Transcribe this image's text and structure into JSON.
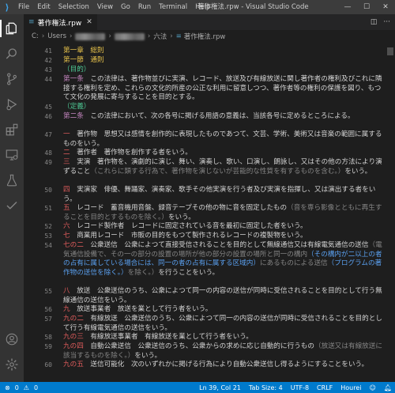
{
  "window": {
    "title": "著作権法.rpw - Visual Studio Code",
    "menu": [
      "File",
      "Edit",
      "Selection",
      "View",
      "Go",
      "Run",
      "Terminal",
      "Help"
    ],
    "controls": [
      "minimize",
      "maximize",
      "close"
    ]
  },
  "activity_bar": {
    "items": [
      "explorer-icon",
      "search-icon",
      "source-control-icon",
      "run-debug-icon",
      "extensions-icon",
      "remote-explorer-icon",
      "testing-icon",
      "check-icon"
    ],
    "bottom": [
      "account-icon",
      "settings-gear-icon"
    ]
  },
  "tabs": [
    {
      "label": "著作権法.rpw",
      "active": true
    }
  ],
  "breadcrumb": {
    "items": [
      "C:",
      "Users",
      "六法",
      "著作権法.rpw"
    ]
  },
  "editor": {
    "lines": [
      {
        "num": "41",
        "segments": [
          {
            "t": "第一章　総則",
            "c": "head"
          }
        ]
      },
      {
        "num": "42",
        "segments": [
          {
            "t": "第一節　通則",
            "c": "head"
          }
        ]
      },
      {
        "num": "43",
        "segments": [
          {
            "t": "（目的）",
            "c": "label"
          }
        ]
      },
      {
        "num": "44",
        "segments": [
          {
            "t": "第一条",
            "c": "art"
          },
          {
            "t": "　この法律は、著作物並びに実演、レコード、放送及び有線放送に関し著作者の権利及びこれに隣接する権利を定め、これらの文化的所産の公正な利用に留意しつつ、著作者等の権利の保護を図り、もつて文化の発展に寄与することを目的とする。",
            "c": ""
          }
        ]
      },
      {
        "num": "45",
        "segments": [
          {
            "t": "（定義）",
            "c": "label"
          }
        ]
      },
      {
        "num": "46",
        "segments": [
          {
            "t": "第二条",
            "c": "art"
          },
          {
            "t": "　この法律において、次の各号に掲げる用語の意義は、当該各号に定めるところによる。",
            "c": ""
          }
        ]
      },
      {
        "num": "47",
        "segments": [
          {
            "t": "一",
            "c": "num"
          },
          {
            "t": "　著作物　思想又は感情を創作的に表現したものであつて、文芸、学術、美術又は音楽の範囲に属するものをいう。",
            "c": ""
          }
        ]
      },
      {
        "num": "48",
        "segments": [
          {
            "t": "二",
            "c": "num"
          },
          {
            "t": "　著作者　著作物を創作する者をいう。",
            "c": ""
          }
        ]
      },
      {
        "num": "49",
        "segments": [
          {
            "t": "三",
            "c": "num"
          },
          {
            "t": "　実演　著作物を、演劇的に演じ、舞い、演奏し、歌い、口演し、朗詠し、又はその他の方法により演ずること",
            "c": ""
          },
          {
            "t": "（これらに類する行為で、著作物を演じないが芸能的な性質を有するものを含む。）",
            "c": "paren"
          },
          {
            "t": "をいう。",
            "c": ""
          }
        ]
      },
      {
        "num": "50",
        "segments": [
          {
            "t": "四",
            "c": "num"
          },
          {
            "t": "　実演家　俳優、舞踊家、演奏家、歌手その他実演を行う者及び実演を指揮し、又は演出する者をいう。",
            "c": ""
          }
        ]
      },
      {
        "num": "51",
        "segments": [
          {
            "t": "五",
            "c": "num"
          },
          {
            "t": "　レコード　蓄音機用音盤、録音テープその他の物に音を固定したもの",
            "c": ""
          },
          {
            "t": "（音を専ら影像とともに再生することを目的とするものを除く。）",
            "c": "paren"
          },
          {
            "t": "をいう。",
            "c": ""
          }
        ]
      },
      {
        "num": "52",
        "segments": [
          {
            "t": "六",
            "c": "num"
          },
          {
            "t": "　レコード製作者　レコードに固定されている音を最初に固定した者をいう。",
            "c": ""
          }
        ]
      },
      {
        "num": "53",
        "segments": [
          {
            "t": "七",
            "c": "num"
          },
          {
            "t": "　商業用レコード　市販の目的をもつて製作されるレコードの複製物をいう。",
            "c": ""
          }
        ]
      },
      {
        "num": "54",
        "segments": [
          {
            "t": "七の二",
            "c": "num"
          },
          {
            "t": "　公衆送信　公衆によつて直接受信されることを目的として無線通信又は有線電気通信の送信",
            "c": ""
          },
          {
            "t": "（電気通信設備で、その一の部分の設置の場所が他の部分の設置の場所と同一の構内",
            "c": "paren"
          },
          {
            "t": "（その構内が二以上の者の占有に属している場合には、同一の者の占有に属する区域内）",
            "c": "blue"
          },
          {
            "t": "にあるものによる送信",
            "c": "paren"
          },
          {
            "t": "（プログラムの著作物の送信を除く。）",
            "c": "blue"
          },
          {
            "t": "を除く。）",
            "c": "paren"
          },
          {
            "t": "を行うことをいう。",
            "c": ""
          }
        ]
      },
      {
        "num": "55",
        "segments": [
          {
            "t": "八",
            "c": "num"
          },
          {
            "t": "　放送　公衆送信のうち、公衆によつて同一の内容の送信が同時に受信されることを目的として行う無線通信の送信をいう。",
            "c": ""
          }
        ]
      },
      {
        "num": "56",
        "segments": [
          {
            "t": "九",
            "c": "num"
          },
          {
            "t": "　放送事業者　放送を業として行う者をいう。",
            "c": ""
          }
        ]
      },
      {
        "num": "57",
        "segments": [
          {
            "t": "九の二",
            "c": "num"
          },
          {
            "t": "　有線放送　公衆送信のうち、公衆によつて同一の内容の送信が同時に受信されることを目的として行う有線電気通信の送信をいう。",
            "c": ""
          }
        ]
      },
      {
        "num": "58",
        "segments": [
          {
            "t": "九の三",
            "c": "num"
          },
          {
            "t": "　有線放送事業者　有線放送を業として行う者をいう。",
            "c": ""
          }
        ]
      },
      {
        "num": "59",
        "segments": [
          {
            "t": "九の四",
            "c": "num"
          },
          {
            "t": "　自動公衆送信　公衆送信のうち、公衆からの求めに応じ自動的に行うもの",
            "c": ""
          },
          {
            "t": "（放送又は有線放送に該当するものを除く。）",
            "c": "paren"
          },
          {
            "t": "をいう。",
            "c": ""
          }
        ]
      },
      {
        "num": "60",
        "segments": [
          {
            "t": "九の五",
            "c": "num"
          },
          {
            "t": "　送信可能化　次のいずれかに掲げる行為により自動公衆送信し得るようにすることをいう。",
            "c": ""
          }
        ]
      }
    ]
  },
  "statusbar": {
    "errors": "0",
    "warnings": "0",
    "position": "Ln 39, Col 21",
    "tab_size": "Tab Size: 4",
    "encoding": "UTF-8",
    "eol": "CRLF",
    "language": "Hourei"
  }
}
